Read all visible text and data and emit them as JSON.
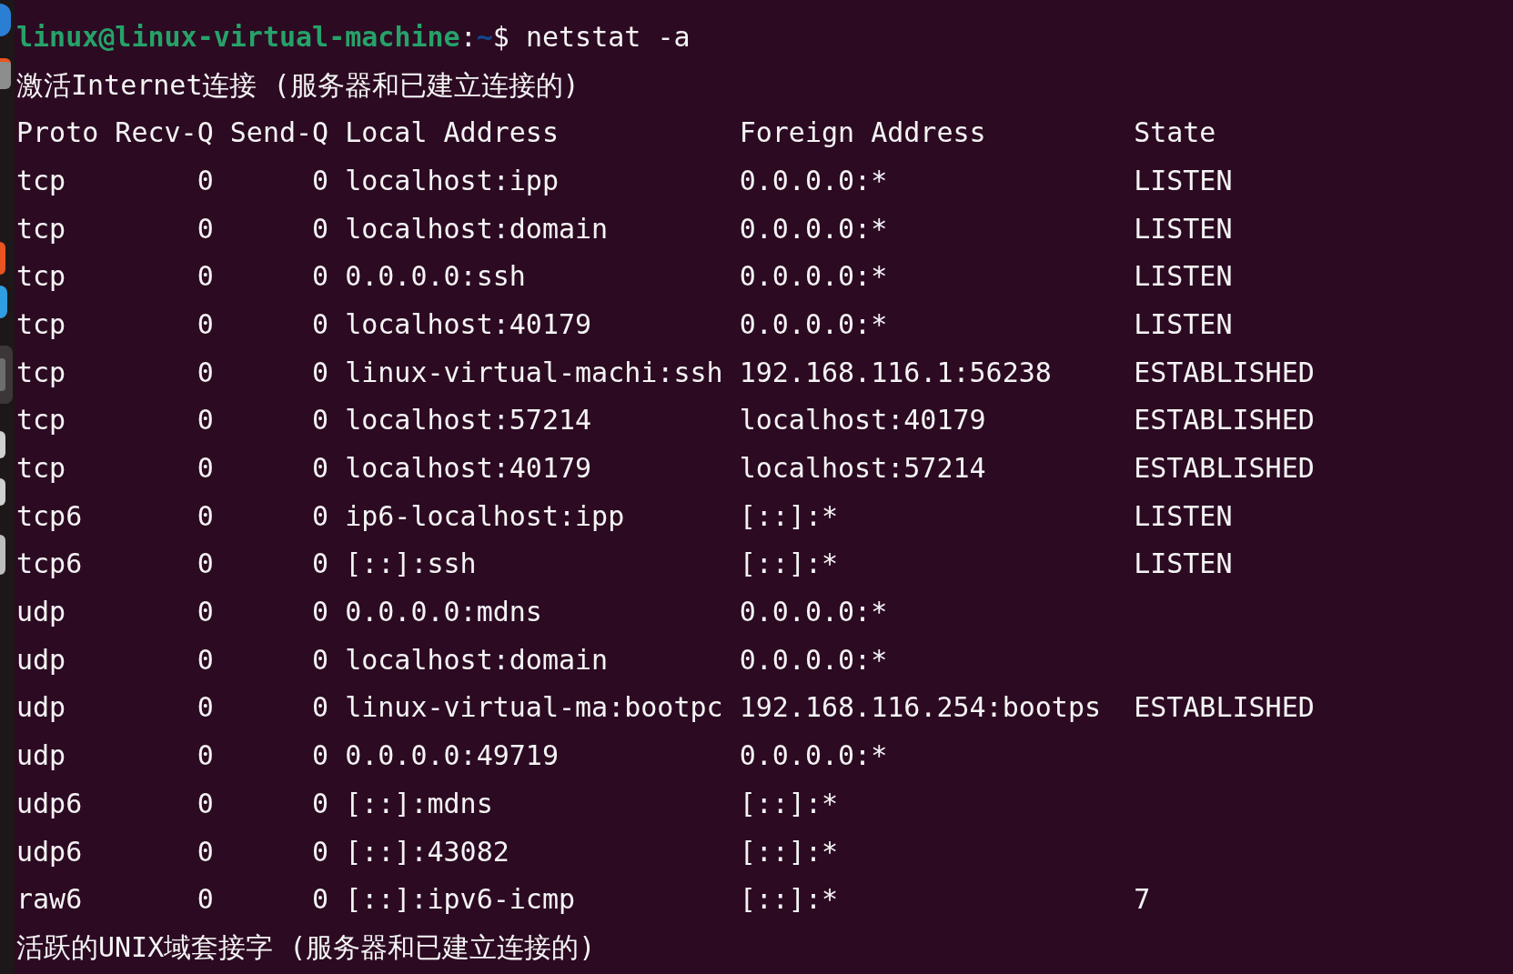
{
  "prompt": {
    "user_host": "linux@linux-virtual-machine",
    "separator": ":",
    "path": "~",
    "command": "$ netstat -a"
  },
  "sections": [
    {
      "title": "激活Internet连接 (服务器和已建立连接的)",
      "columns": [
        "Proto",
        "Recv-Q",
        "Send-Q",
        "Local Address",
        "Foreign Address",
        "State"
      ],
      "rows": [
        {
          "proto": "tcp",
          "recv_q": "0",
          "send_q": "0",
          "local": "localhost:ipp",
          "foreign": "0.0.0.0:*",
          "state": "LISTEN"
        },
        {
          "proto": "tcp",
          "recv_q": "0",
          "send_q": "0",
          "local": "localhost:domain",
          "foreign": "0.0.0.0:*",
          "state": "LISTEN"
        },
        {
          "proto": "tcp",
          "recv_q": "0",
          "send_q": "0",
          "local": "0.0.0.0:ssh",
          "foreign": "0.0.0.0:*",
          "state": "LISTEN"
        },
        {
          "proto": "tcp",
          "recv_q": "0",
          "send_q": "0",
          "local": "localhost:40179",
          "foreign": "0.0.0.0:*",
          "state": "LISTEN"
        },
        {
          "proto": "tcp",
          "recv_q": "0",
          "send_q": "0",
          "local": "linux-virtual-machi:ssh",
          "foreign": "192.168.116.1:56238",
          "state": "ESTABLISHED"
        },
        {
          "proto": "tcp",
          "recv_q": "0",
          "send_q": "0",
          "local": "localhost:57214",
          "foreign": "localhost:40179",
          "state": "ESTABLISHED"
        },
        {
          "proto": "tcp",
          "recv_q": "0",
          "send_q": "0",
          "local": "localhost:40179",
          "foreign": "localhost:57214",
          "state": "ESTABLISHED"
        },
        {
          "proto": "tcp6",
          "recv_q": "0",
          "send_q": "0",
          "local": "ip6-localhost:ipp",
          "foreign": "[::]:*",
          "state": "LISTEN"
        },
        {
          "proto": "tcp6",
          "recv_q": "0",
          "send_q": "0",
          "local": "[::]:ssh",
          "foreign": "[::]:*",
          "state": "LISTEN"
        },
        {
          "proto": "udp",
          "recv_q": "0",
          "send_q": "0",
          "local": "0.0.0.0:mdns",
          "foreign": "0.0.0.0:*"
        },
        {
          "proto": "udp",
          "recv_q": "0",
          "send_q": "0",
          "local": "localhost:domain",
          "foreign": "0.0.0.0:*"
        },
        {
          "proto": "udp",
          "recv_q": "0",
          "send_q": "0",
          "local": "linux-virtual-ma:bootpc",
          "foreign": "192.168.116.254:bootps",
          "state": "ESTABLISHED"
        },
        {
          "proto": "udp",
          "recv_q": "0",
          "send_q": "0",
          "local": "0.0.0.0:49719",
          "foreign": "0.0.0.0:*"
        },
        {
          "proto": "udp6",
          "recv_q": "0",
          "send_q": "0",
          "local": "[::]:mdns",
          "foreign": "[::]:*"
        },
        {
          "proto": "udp6",
          "recv_q": "0",
          "send_q": "0",
          "local": "[::]:43082",
          "foreign": "[::]:*"
        },
        {
          "proto": "raw6",
          "recv_q": "0",
          "send_q": "0",
          "local": "[::]:ipv6-icmp",
          "foreign": "[::]:*",
          "state": "7"
        }
      ]
    },
    {
      "title": "活跃的UNIX域套接字 (服务器和已建立连接的)"
    }
  ]
}
